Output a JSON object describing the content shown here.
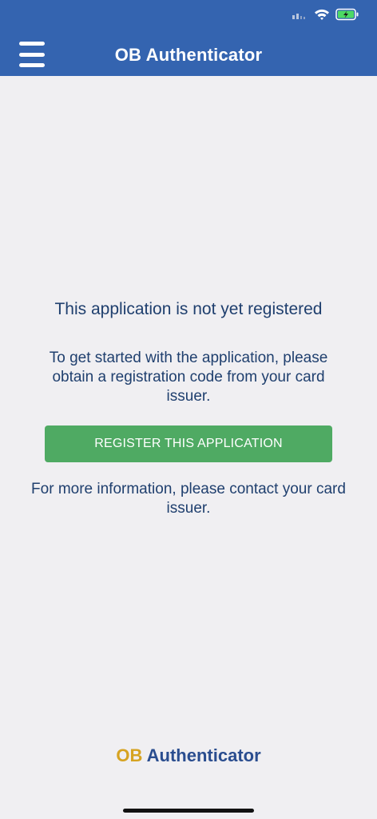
{
  "header": {
    "title": "OB Authenticator",
    "menu_icon": "hamburger-menu-icon",
    "background_color": "#3464b0"
  },
  "status_bar": {
    "icons": [
      "cellular-signal-icon",
      "wifi-icon",
      "battery-charging-icon"
    ]
  },
  "main": {
    "headline": "This application is not yet registered",
    "instructions": "To get started with the application, please obtain a registration code from your card issuer.",
    "register_button_label": "REGISTER THIS APPLICATION",
    "more_info": "For more information, please contact your card issuer."
  },
  "footer": {
    "logo_prefix": "OB",
    "logo_suffix": "Authenticator"
  },
  "colors": {
    "accent_green": "#4faa63",
    "text_blue": "#1f3f6e",
    "logo_gold": "#d6a321",
    "battery_green": "#4cd964"
  }
}
